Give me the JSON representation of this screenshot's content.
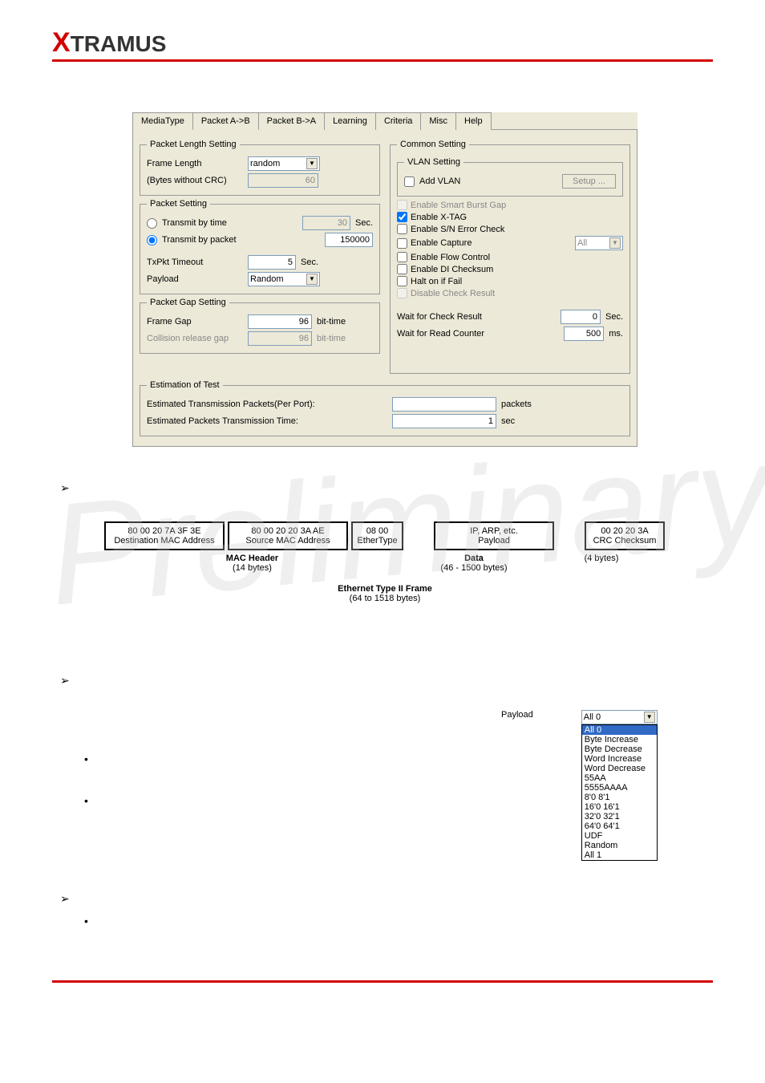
{
  "logo": "XTRAMUS",
  "tabs": [
    "MediaType",
    "Packet A->B",
    "Packet B->A",
    "Learning",
    "Criteria",
    "Misc",
    "Help"
  ],
  "pls": {
    "title": "Packet Length Setting",
    "frame_len": "Frame Length",
    "fl_val": "random",
    "bytes": "(Bytes without CRC)",
    "bytes_val": "60"
  },
  "ps": {
    "title": "Packet Setting",
    "tbt": "Transmit by time",
    "tbt_v": "30",
    "tbp": "Transmit by packet",
    "tbp_v": "150000",
    "sec": "Sec.",
    "txto": "TxPkt Timeout",
    "txto_v": "5",
    "payload": "Payload",
    "pay_v": "Random"
  },
  "pgs": {
    "title": "Packet Gap Setting",
    "fg": "Frame Gap",
    "fg_v": "96",
    "bt": "bit-time",
    "crg": "Collision release gap",
    "crg_v": "96"
  },
  "cs": {
    "title": "Common Setting",
    "vlan": "VLAN Setting",
    "addvlan": "Add VLAN",
    "setup": "Setup ...",
    "esbg": "Enable Smart Burst Gap",
    "ext": "Enable X-TAG",
    "esn": "Enable S/N Error Check",
    "ecap": "Enable Capture",
    "all": "All",
    "efc": "Enable Flow Control",
    "edi": "Enable DI Checksum",
    "halt": "Halt on if Fail",
    "dcr": "Disable Check Result",
    "wcr": "Wait for Check Result",
    "wcr_v": "0",
    "wrc": "Wait for Read Counter",
    "wrc_v": "500",
    "secu": "Sec.",
    "ms": "ms."
  },
  "eot": {
    "title": "Estimation of Test",
    "etp": "Estimated Transmission Packets(Per Port):",
    "ept": "Estimated Packets Transmission Time:",
    "v1": "",
    "v2": "1",
    "pk": "packets",
    "sc": "sec"
  },
  "diagram": {
    "dmac": "80 00 20 7A 3F 3E",
    "dmacl": "Destination MAC Address",
    "smac": "80 00 20 20 3A AE",
    "smacl": "Source MAC Address",
    "et": "08 00",
    "etl": "EtherType",
    "pay": "IP, ARP, etc.",
    "payl": "Payload",
    "crc": "00 20 20 3A",
    "crcl": "CRC Checksum",
    "mh": "MAC Header",
    "mhb": "(14 bytes)",
    "data": "Data",
    "datab": "(46 - 1500 bytes)",
    "four": "(4 bytes)",
    "t2f": "Ethernet Type II Frame",
    "t2fb": "(64 to 1518 bytes)"
  },
  "pdd": {
    "lbl": "Payload",
    "val": "All 0",
    "opts": [
      "All 0",
      "Byte Increase",
      "Byte Decrease",
      "Word Increase",
      "Word Decrease",
      "55AA",
      "5555AAAA",
      "8'0 8'1",
      "16'0 16'1",
      "32'0 32'1",
      "64'0 64'1",
      "UDF",
      "Random",
      "All 1"
    ]
  }
}
